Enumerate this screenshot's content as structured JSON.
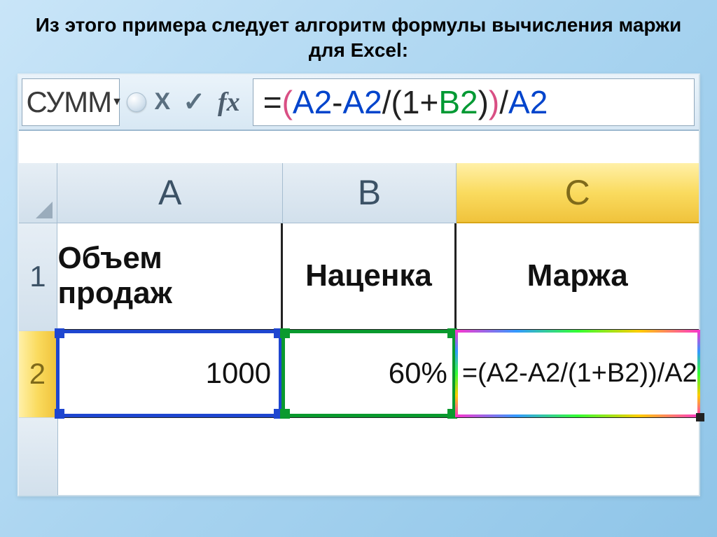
{
  "slide": {
    "title": "Из этого примера следует алгоритм формулы вычисления маржи для Excel:"
  },
  "formula_bar": {
    "name_box": "СУММ",
    "cancel_icon": "X",
    "confirm_icon": "✓",
    "fx_label": "fx",
    "formula_tokens": {
      "eq": "=",
      "op1": "(",
      "a2_1": "A2",
      "minus": "-",
      "a2_2": "A2",
      "slash1": "/",
      "op2": "(",
      "one": "1",
      "plus": "+",
      "b2": "B2",
      "cp1": ")",
      "cp2": ")",
      "slash2": "/",
      "a2_3": "A2"
    }
  },
  "columns": {
    "A": "A",
    "B": "B",
    "C": "C"
  },
  "rows": {
    "r1": "1",
    "r2": "2"
  },
  "cells": {
    "A1": "Объем продаж",
    "B1": "Наценка",
    "C1": "Маржа",
    "A2": "1000",
    "B2": "60%",
    "C2": "=(A2-A2/(1+B2))/A2"
  }
}
